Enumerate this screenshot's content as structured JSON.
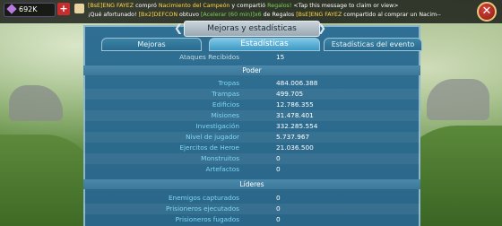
{
  "topbar": {
    "gems": "692K",
    "chat_line1": {
      "tag": "[BsE]ENG FAYEZ",
      "t1": " compró ",
      "item": "Nacimiento del Campeón",
      "t2": " y compartió ",
      "gift": "Regalos!",
      "t3": " <Tap this message to claim or view>"
    },
    "chat_line2": {
      "t1": "¡Qué afortunado! ",
      "player": "[Bx2]DEFCON",
      "t2": " obtuvo ",
      "boost": "[Acelerar (60 min)]x6",
      "t3": " de Regalos ",
      "tag": "[BsE]ENG FAYEZ",
      "t4": " compartido al comprar un Nacim--"
    }
  },
  "panel": {
    "title": "Mejoras y estadísticas",
    "tabs": [
      "Mejoras",
      "Estadísticas",
      "Estadísticas del evento"
    ],
    "top_row": {
      "label": "Ataques Recibidos",
      "value": "15"
    },
    "sections": [
      {
        "title": "Poder",
        "rows": [
          {
            "label": "Tropas",
            "value": "484.006.388"
          },
          {
            "label": "Trampas",
            "value": "499.705"
          },
          {
            "label": "Edificios",
            "value": "12.786.355"
          },
          {
            "label": "Misiones",
            "value": "31.478.401"
          },
          {
            "label": "Investigación",
            "value": "332.285.554"
          },
          {
            "label": "Nivel de jugador",
            "value": "5.737.967"
          },
          {
            "label": "Ejercitos de Heroe",
            "value": "21.036.500"
          },
          {
            "label": "Monstruitos",
            "value": "0"
          },
          {
            "label": "Artefactos",
            "value": "0"
          }
        ]
      },
      {
        "title": "Líderes",
        "rows": [
          {
            "label": "Enemigos capturados",
            "value": "0"
          },
          {
            "label": "Prisioneros ejecutados",
            "value": "0"
          },
          {
            "label": "Prisioneros fugados",
            "value": "0"
          }
        ]
      }
    ]
  }
}
